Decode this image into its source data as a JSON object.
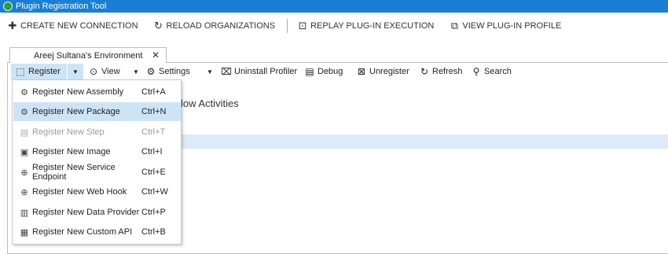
{
  "window": {
    "title": "Plugin Registration Tool",
    "icon": "plugin-registration-app-icon"
  },
  "main_toolbar": [
    {
      "icon": "plus-icon",
      "label": "CREATE NEW CONNECTION"
    },
    {
      "icon": "reload-icon",
      "label": "RELOAD ORGANIZATIONS"
    },
    {
      "icon": "replay-icon",
      "label": "REPLAY PLUG-IN EXECUTION"
    },
    {
      "icon": "profile-icon",
      "label": "VIEW PLUG-IN PROFILE"
    }
  ],
  "tab": {
    "label": "Areej Sultana's Environment",
    "close": "✕"
  },
  "toolbar": {
    "register": "Register",
    "view": "View",
    "settings": "Settings",
    "uninstall_profiler": "Uninstall Profiler",
    "debug": "Debug",
    "unregister": "Unregister",
    "refresh": "Refresh",
    "search": "Search"
  },
  "background_text": "low Activities",
  "register_menu": [
    {
      "label": "Register New Assembly",
      "shortcut": "Ctrl+A",
      "icon": "assembly-icon",
      "state": "normal"
    },
    {
      "label": "Register New Package",
      "shortcut": "Ctrl+N",
      "icon": "package-icon",
      "state": "highlighted"
    },
    {
      "label": "Register New Step",
      "shortcut": "Ctrl+T",
      "icon": "step-icon",
      "state": "disabled"
    },
    {
      "label": "Register New Image",
      "shortcut": "Ctrl+I",
      "icon": "image-icon",
      "state": "normal"
    },
    {
      "label": "Register New Service Endpoint",
      "shortcut": "Ctrl+E",
      "icon": "service-endpoint-icon",
      "state": "normal"
    },
    {
      "label": "Register New Web Hook",
      "shortcut": "Ctrl+W",
      "icon": "web-hook-icon",
      "state": "normal"
    },
    {
      "label": "Register New Data Provider",
      "shortcut": "Ctrl+P",
      "icon": "data-provider-icon",
      "state": "normal"
    },
    {
      "label": "Register New Custom API",
      "shortcut": "Ctrl+B",
      "icon": "custom-api-icon",
      "state": "normal"
    }
  ]
}
